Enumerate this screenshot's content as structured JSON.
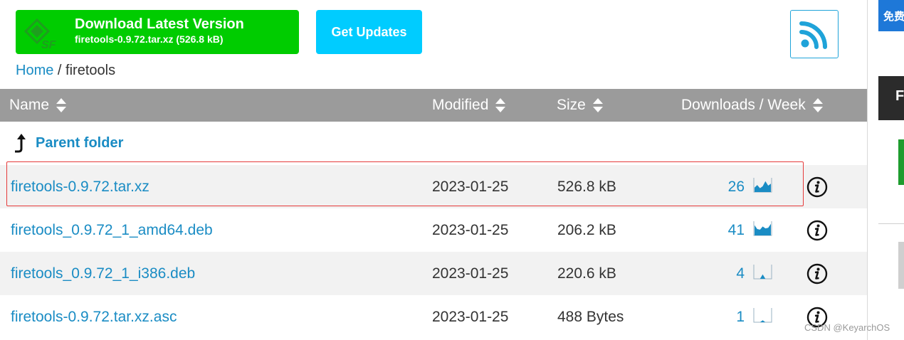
{
  "header": {
    "download_button": {
      "title": "Download Latest Version",
      "subtitle": "firetools-0.9.72.tar.xz (526.8 kB)",
      "logo_text": "SF",
      "color": "#00cc00"
    },
    "updates_button": {
      "label": "Get Updates",
      "color": "#00ccff"
    },
    "rss_icon": "rss-icon"
  },
  "breadcrumb": {
    "home": "Home",
    "separator": "/",
    "current": "firetools"
  },
  "table": {
    "columns": [
      "Name",
      "Modified",
      "Size",
      "Downloads / Week"
    ],
    "parent_label": "Parent folder",
    "rows": [
      {
        "name": "firetools-0.9.72.tar.xz",
        "modified": "2023-01-25",
        "size": "526.8 kB",
        "downloads": "26",
        "spark": [
          0.35,
          0.55,
          0.3,
          0.45,
          0.85,
          0.5,
          0.65
        ]
      },
      {
        "name": "firetools_0.9.72_1_amd64.deb",
        "modified": "2023-01-25",
        "size": "206.2 kB",
        "downloads": "41",
        "spark": [
          0.8,
          0.5,
          0.45,
          0.7,
          0.55,
          0.6,
          0.9
        ]
      },
      {
        "name": "firetools_0.9.72_1_i386.deb",
        "modified": "2023-01-25",
        "size": "220.6 kB",
        "downloads": "4",
        "spark": [
          0,
          0,
          0,
          0.35,
          0,
          0,
          0
        ]
      },
      {
        "name": "firetools-0.9.72.tar.xz.asc",
        "modified": "2023-01-25",
        "size": "488 Bytes",
        "downloads": "1",
        "spark": [
          0,
          0,
          0,
          0.15,
          0,
          0,
          0
        ]
      }
    ]
  },
  "sidebar": {
    "top_button": "免费",
    "dark_block": "F"
  },
  "watermark": "CSDN @KeyarchOS",
  "colors": {
    "link": "#1a8cc4",
    "header_bg": "#9b9b9b",
    "highlight": "#e53a3a"
  }
}
